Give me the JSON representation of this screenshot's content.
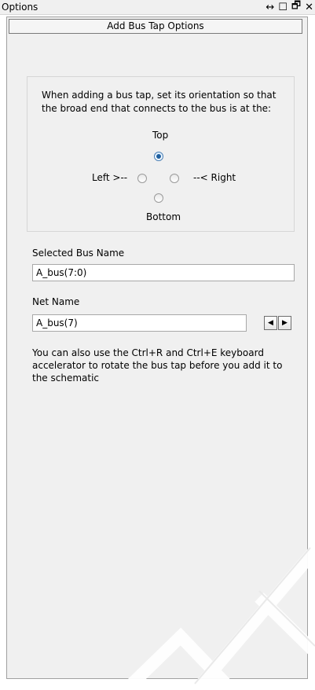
{
  "window": {
    "title": "Options"
  },
  "panel": {
    "header": "Add Bus Tap Options"
  },
  "orientation": {
    "description": "When adding a bus tap, set its orientation so that the broad end that connects to the bus is at the:",
    "top_label": "Top",
    "left_label": "Left >--",
    "right_label": "--< Right",
    "bottom_label": "Bottom",
    "selected": "top"
  },
  "selected_bus": {
    "label": "Selected Bus Name",
    "value": "A_bus(7:0)"
  },
  "net_name": {
    "label": "Net Name",
    "value": "A_bus(7)"
  },
  "info_text": "You can also use the Ctrl+R and Ctrl+E keyboard accelerator to rotate the bus tap before you add it to the schematic",
  "icons": {
    "title_bar": [
      "resize-arrows-icon",
      "maximize-icon",
      "float-icon",
      "close-icon"
    ],
    "net_nav": [
      "arrow-left-icon",
      "arrow-right-icon"
    ]
  }
}
